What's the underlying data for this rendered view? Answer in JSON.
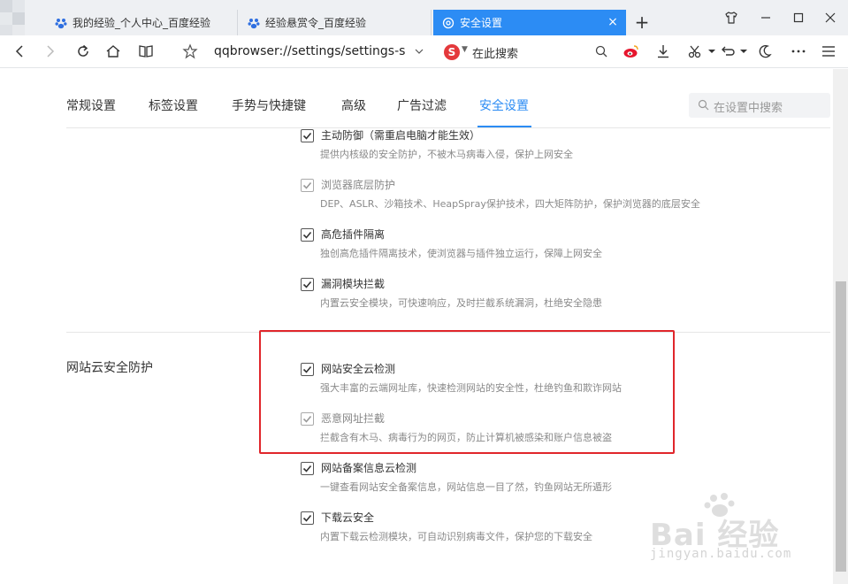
{
  "browser": {
    "tabs": [
      {
        "title": "我的经验_个人中心_百度经验",
        "icon": "baidu-paw-icon",
        "active": false
      },
      {
        "title": "经验悬赏令_百度经验",
        "icon": "baidu-paw-icon",
        "active": false
      },
      {
        "title": "安全设置",
        "icon": "settings-gear-icon",
        "active": true
      }
    ],
    "url": "qqbrowser://settings/settings-s",
    "search_placeholder": "在此搜索",
    "search_logo": "S"
  },
  "settings": {
    "nav": [
      {
        "label": "常规设置"
      },
      {
        "label": "标签设置"
      },
      {
        "label": "手势与快捷键"
      },
      {
        "label": "高级"
      },
      {
        "label": "广告过滤"
      },
      {
        "label": "安全设置"
      }
    ],
    "active_tab": "安全设置",
    "search_placeholder": "在设置中搜索",
    "options_top": [
      {
        "label": "主动防御（需重启电脑才能生效）",
        "desc": "提供内核级的安全防护，不被木马病毒入侵，保护上网安全",
        "checked": true,
        "disabled": false
      },
      {
        "label": "浏览器底层防护",
        "desc": "DEP、ASLR、沙箱技术、HeapSpray保护技术，四大矩阵防护，保护浏览器的底层安全",
        "checked": true,
        "disabled": true
      },
      {
        "label": "高危插件隔离",
        "desc": "独创高危插件隔离技术，使浏览器与插件独立运行，保障上网安全",
        "checked": true,
        "disabled": false
      },
      {
        "label": "漏洞模块拦截",
        "desc": "内置云安全模块，可快速响应，及时拦截系统漏洞，杜绝安全隐患",
        "checked": true,
        "disabled": false
      }
    ],
    "section_title": "网站云安全防护",
    "options_web": [
      {
        "label": "网站安全云检测",
        "desc": "强大丰富的云端网址库，快速检测网站的安全性，杜绝钓鱼和欺诈网站",
        "checked": true,
        "disabled": false
      },
      {
        "label": "恶意网址拦截",
        "desc": "拦截含有木马、病毒行为的网页，防止计算机被感染和账户信息被盗",
        "checked": true,
        "disabled": true
      },
      {
        "label": "网站备案信息云检测",
        "desc": "一键查看网站安全备案信息，网站信息一目了然，钓鱼网站无所遁形",
        "checked": true,
        "disabled": false
      },
      {
        "label": "下载云安全",
        "desc": "内置下载云检测模块，可自动识别病毒文件，保护您的下载安全",
        "checked": true,
        "disabled": false
      }
    ]
  },
  "colors": {
    "accent": "#2c8cf4",
    "highlight": "#e0262b"
  },
  "watermark": {
    "text": "Bai 经验",
    "sub": "jingyan.baidu.com"
  }
}
